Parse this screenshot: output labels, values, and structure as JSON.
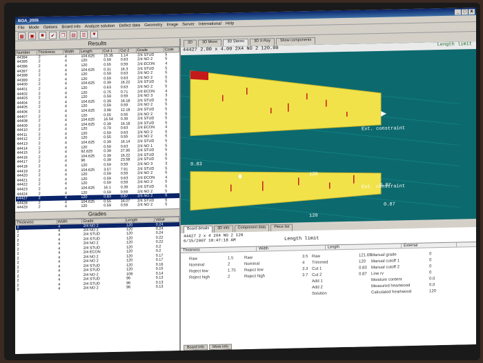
{
  "app": {
    "title": "BOA_2005"
  },
  "window_buttons": [
    "_",
    "□",
    "X"
  ],
  "menu": [
    "File",
    "Mode",
    "Options",
    "Board info",
    "Analyze solution",
    "Defect data",
    "Geometry",
    "Image",
    "Server",
    "International",
    "Help"
  ],
  "toolbar_icons": [
    "grid-icon",
    "window-icon",
    "save-icon",
    "check-icon",
    "copy-icon",
    "page-icon",
    "list-icon",
    "filter-icon"
  ],
  "results": {
    "title": "Results",
    "columns": [
      "Number",
      "Thickness",
      "Width",
      "Length",
      "Cut 1",
      "Cut 2",
      "Grade",
      "Code"
    ],
    "rows": [
      [
        "44394",
        "2",
        "4",
        "104.625",
        "15.35",
        "1.14",
        "2/4 STUD",
        "5"
      ],
      [
        "44395",
        "2",
        "4",
        "120",
        "0.59",
        "0.63",
        "2/4 NO 2",
        "5"
      ],
      [
        "44396",
        "2",
        "4",
        "120",
        "0.55",
        "0.59",
        "2/4 ECON",
        "4"
      ],
      [
        "44397",
        "2",
        "4",
        "104.625",
        "0.31",
        "16.3",
        "2/4 STUD",
        "5"
      ],
      [
        "44398",
        "2",
        "4",
        "120",
        "0.59",
        "0.63",
        "2/4 NO 2",
        "5"
      ],
      [
        "44399",
        "2",
        "4",
        "120",
        "0.59",
        "0.63",
        "2/4 NO 2",
        "5"
      ],
      [
        "44400",
        "2",
        "4",
        "104.625",
        "0.39",
        "16.22",
        "2/4 STUD",
        "5"
      ],
      [
        "44401",
        "2",
        "4",
        "120",
        "0.63",
        "0.63",
        "2/4 NO 2",
        "5"
      ],
      [
        "44402",
        "2",
        "4",
        "120",
        "0.75",
        "0.71",
        "2/4 ECON",
        "4"
      ],
      [
        "44403",
        "2",
        "4",
        "120",
        "0.59",
        "0.59",
        "2/4 NO 3",
        "3"
      ],
      [
        "44404",
        "2",
        "4",
        "104.625",
        "0.39",
        "16.18",
        "2/4 STUD",
        "5"
      ],
      [
        "44405",
        "2",
        "4",
        "120",
        "0.59",
        "0.59",
        "2/4 NO 2",
        "5"
      ],
      [
        "44406",
        "2",
        "4",
        "104.625",
        "3.98",
        "12.18",
        "2/4 STUD",
        "5"
      ],
      [
        "44407",
        "2",
        "4",
        "120",
        "0.55",
        "0.55",
        "2/4 NO 2",
        "5"
      ],
      [
        "44408",
        "2",
        "4",
        "104.625",
        "16.54",
        "0.39",
        "2/4 STUD",
        "5"
      ],
      [
        "44409",
        "2",
        "4",
        "104.625",
        "0.39",
        "16.18",
        "2/4 STUD",
        "5"
      ],
      [
        "44410",
        "2",
        "4",
        "120",
        "0.79",
        "0.63",
        "2/4 ECON",
        "4"
      ],
      [
        "44411",
        "2",
        "4",
        "120",
        "0.59",
        "0.63",
        "2/4 NO 2",
        "5"
      ],
      [
        "44412",
        "2",
        "4",
        "120",
        "0.55",
        "0.55",
        "2/4 NO 2",
        "5"
      ],
      [
        "44413",
        "2",
        "4",
        "104.625",
        "0.39",
        "16.14",
        "2/4 STUD",
        "5"
      ],
      [
        "44414",
        "2",
        "4",
        "120",
        "0.59",
        "0.63",
        "2/4 NO 1",
        "5"
      ],
      [
        "44415",
        "2",
        "4",
        "92.625",
        "0.39",
        "27.95",
        "2/4 STUD",
        "5"
      ],
      [
        "44416",
        "2",
        "4",
        "104.625",
        "0.39",
        "16.22",
        "2/4 STUD",
        "5"
      ],
      [
        "44417",
        "2",
        "4",
        "96",
        "0.39",
        "23.58",
        "2/4 STUD",
        "5"
      ],
      [
        "44418",
        "2",
        "4",
        "120",
        "0.59",
        "0.59",
        "2/4 NO 3",
        "3"
      ],
      [
        "44419",
        "2",
        "4",
        "104.625",
        "3.57",
        "7.91",
        "2/4 STUD",
        "5"
      ],
      [
        "44420",
        "2",
        "4",
        "120",
        "0.59",
        "0.59",
        "2/4 NO 2",
        "5"
      ],
      [
        "44421",
        "2",
        "4",
        "120",
        "0.59",
        "0.63",
        "2/4 ECON",
        "4"
      ],
      [
        "44422",
        "2",
        "4",
        "120",
        "0.59",
        "0.59",
        "2/4 NO 2",
        "5"
      ],
      [
        "44423",
        "2",
        "4",
        "104.625",
        "16.1",
        "0.39",
        "2/4 STUD",
        "5"
      ],
      [
        "44424",
        "2",
        "4",
        "120",
        "0.59",
        "0.59",
        "2/4 NO 2",
        "5"
      ],
      [
        "44427",
        "2",
        "4",
        "120",
        "0.83",
        "0.87",
        "2/4 NO 2",
        "5"
      ],
      [
        "44428",
        "2",
        "4",
        "104.625",
        "0.55",
        "16.07",
        "2/4 STUD",
        "5"
      ],
      [
        "44429",
        "2",
        "4",
        "120",
        "0.59",
        "0.59",
        "2/4 NO 2",
        "5"
      ]
    ],
    "selected_index": 31
  },
  "grades": {
    "title": "Grades",
    "columns": [
      "Thickness",
      "Width",
      "Grade",
      "Length",
      "Value"
    ],
    "rows": [
      [
        "2",
        "4",
        "2/4 NO 2",
        "120",
        "0.24"
      ],
      [
        "2",
        "4",
        "2/4 NO 2",
        "120",
        "0.24"
      ],
      [
        "2",
        "4",
        "2/4 STUD",
        "120",
        "0.24"
      ],
      [
        "2",
        "4",
        "2/4 STUD",
        "120",
        "0.22"
      ],
      [
        "2",
        "4",
        "2/4 NO 2",
        "120",
        "0.22"
      ],
      [
        "2",
        "4",
        "2/4 STUD",
        "120",
        "0.2"
      ],
      [
        "2",
        "4",
        "2/4 ECON",
        "120",
        "0.2"
      ],
      [
        "2",
        "4",
        "2/4 NO 2",
        "120",
        "0.17"
      ],
      [
        "2",
        "4",
        "2/4 NO 2",
        "120",
        "0.17"
      ],
      [
        "2",
        "4",
        "2/4 STUD",
        "120",
        "0.16"
      ],
      [
        "2",
        "4",
        "2/4 STUD",
        "120",
        "0.15"
      ],
      [
        "2",
        "4",
        "2/4 NO 2",
        "108",
        "0.14"
      ],
      [
        "2",
        "4",
        "2/4 STUD",
        "96",
        "0.13"
      ],
      [
        "2",
        "4",
        "2/4 STUD",
        "96",
        "0.13"
      ],
      [
        "2",
        "4",
        "2/4 NO 2",
        "96",
        "0.13"
      ]
    ]
  },
  "view_tabs": [
    "2D",
    "3D Mono",
    "3D Stereo",
    "3D X-Ray",
    "Show components"
  ],
  "view_active_tab": 2,
  "view": {
    "header": "44427  2.00 x 4.00 2X4 NO 2 120.00",
    "status": "Length limit",
    "label_ext1": "Ext. constraint",
    "label_ext2": "Ext. constraint",
    "left_top": "0.83",
    "mid_top": "120",
    "right_mid": "0.87",
    "mid_bot": "120",
    "right_bot": "0.87",
    "colors": {
      "board": "#f2e24a",
      "background": "#0c6a6e",
      "defect": "#c41a1a"
    }
  },
  "bottom_tabs": [
    "Board details",
    "3D info",
    "Component data",
    "Piece list"
  ],
  "bottom_active_tab": 0,
  "board_info": {
    "line1": "44427    2 x 4    2X4 NO 2    120",
    "line2": "6/15/2007    10:47:18 AM",
    "status": "Length limit"
  },
  "detail_columns": [
    "Thickness",
    "Width",
    "Length",
    "External"
  ],
  "detail": {
    "col1": [
      "Raw",
      "Nominal",
      "Reject low",
      "Reject high"
    ],
    "col2": [
      "1.5",
      "2",
      "1.75",
      "2"
    ],
    "col3": [
      "Raw",
      "Nominal",
      "Reject low",
      "Reject high"
    ],
    "col4": [
      "3.5",
      "4",
      "3.3",
      "3.7"
    ],
    "col5": [
      "Raw",
      "Trimmed",
      "Cut 1",
      "Cut 2",
      "Add 1",
      "Add 2",
      "Solution"
    ],
    "col6": [
      "121.69",
      "120",
      "0.83",
      "0.87"
    ],
    "col7": [
      "Manual grade",
      "Manual cutoff 1",
      "Manual cutoff 2",
      "Line rv",
      "Moisture content",
      "Measured heartwood",
      "Calculated heartwood"
    ],
    "col8": [
      "0",
      "0",
      "0",
      "0",
      "0.0",
      "0.0",
      "120"
    ]
  },
  "footer_tabs": [
    "Board info",
    "More info"
  ]
}
